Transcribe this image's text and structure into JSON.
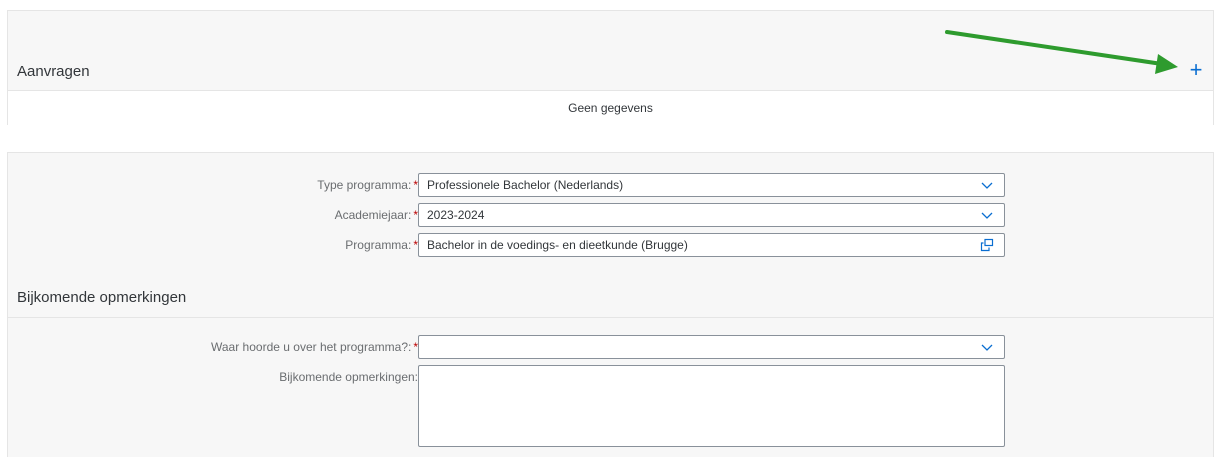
{
  "requests": {
    "title": "Aanvragen",
    "add_label": "+",
    "empty_text": "Geen gegevens"
  },
  "form": {
    "type_programma": {
      "label": "Type programma:",
      "value": "Professionele Bachelor (Nederlands)"
    },
    "academiejaar": {
      "label": "Academiejaar:",
      "value": "2023-2024"
    },
    "programma": {
      "label": "Programma:",
      "value": "Bachelor in de voedings- en dieetkunde (Brugge)"
    },
    "required_marker": "*"
  },
  "remarks": {
    "section_title": "Bijkomende opmerkingen",
    "waar_hoorde": {
      "label": "Waar hoorde u over het programma?:",
      "value": ""
    },
    "opmerkingen": {
      "label": "Bijkomende opmerkingen:",
      "value": ""
    }
  },
  "colors": {
    "accent": "#0a6ed1",
    "arrow": "#2e9b2e",
    "required": "#bb0000"
  },
  "icons": {
    "add": "plus-icon",
    "dropdown": "chevron-down-icon",
    "value_help": "value-help-icon"
  }
}
